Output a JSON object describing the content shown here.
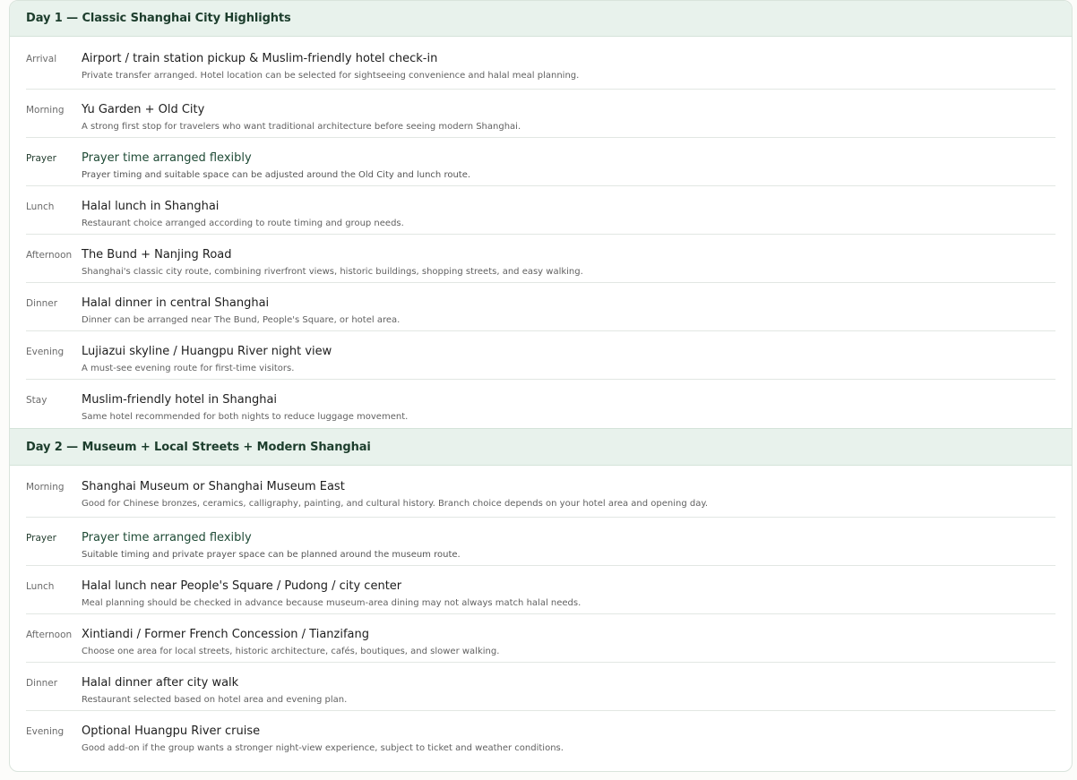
{
  "day1": {
    "title": "Day 1 — Classic Shanghai City Highlights",
    "items": [
      {
        "label": "Arrival",
        "title": "Airport / train station pickup & Muslim-friendly hotel check-in",
        "desc": "Private transfer arranged. Hotel location can be selected for sightseeing convenience and halal meal planning."
      },
      {
        "label": "Morning",
        "title": "Yu Garden + Old City",
        "desc": "A strong first stop for travelers who want traditional architecture before seeing modern Shanghai."
      },
      {
        "label": "Prayer",
        "title": "Prayer time arranged flexibly",
        "desc": "Prayer timing and suitable space can be adjusted around the Old City and lunch route."
      },
      {
        "label": "Lunch",
        "title": "Halal lunch in Shanghai",
        "desc": "Restaurant choice arranged according to route timing and group needs."
      },
      {
        "label": "Afternoon",
        "title": "The Bund + Nanjing Road",
        "desc": "Shanghai's classic city route, combining riverfront views, historic buildings, shopping streets, and easy walking."
      },
      {
        "label": "Dinner",
        "title": "Halal dinner in central Shanghai",
        "desc": "Dinner can be arranged near The Bund, People's Square, or hotel area."
      },
      {
        "label": "Evening",
        "title": "Lujiazui skyline / Huangpu River night view",
        "desc": "A must-see evening route for first-time visitors."
      },
      {
        "label": "Stay",
        "title": "Muslim-friendly hotel in Shanghai",
        "desc": "Same hotel recommended for both nights to reduce luggage movement."
      }
    ]
  },
  "day2": {
    "title": "Day 2 — Museum + Local Streets + Modern Shanghai",
    "items": [
      {
        "label": "Morning",
        "title": "Shanghai Museum or Shanghai Museum East",
        "desc": "Good for Chinese bronzes, ceramics, calligraphy, painting, and cultural history. Branch choice depends on your hotel area and opening day."
      },
      {
        "label": "Prayer",
        "title": "Prayer time arranged flexibly",
        "desc": "Suitable timing and private prayer space can be planned around the museum route."
      },
      {
        "label": "Lunch",
        "title": "Halal lunch near People's Square / Pudong / city center",
        "desc": "Meal planning should be checked in advance because museum-area dining may not always match halal needs."
      },
      {
        "label": "Afternoon",
        "title": "Xintiandi / Former French Concession / Tianzifang",
        "desc": "Choose one area for local streets, historic architecture, cafés, boutiques, and slower walking."
      },
      {
        "label": "Dinner",
        "title": "Halal dinner after city walk",
        "desc": "Restaurant selected based on hotel area and evening plan."
      },
      {
        "label": "Evening",
        "title": "Optional Huangpu River cruise",
        "desc": "Good add-on if the group wants a stronger night-view experience, subject to ticket and weather conditions."
      }
    ]
  }
}
